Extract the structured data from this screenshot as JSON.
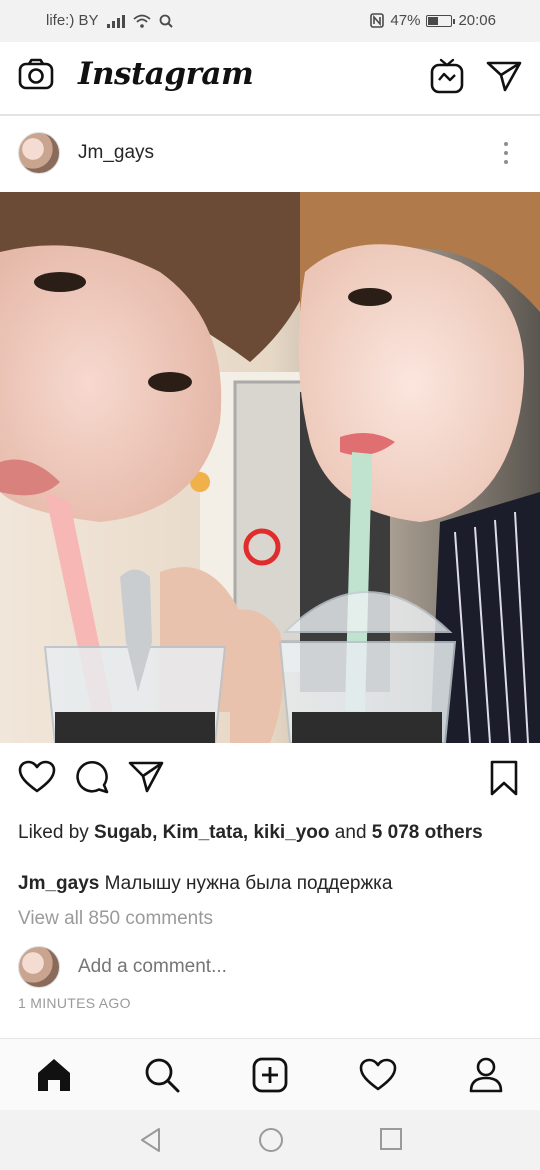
{
  "status_bar": {
    "carrier": "life:) BY",
    "battery_percent": "47%",
    "battery_level": 0.47,
    "time": "20:06",
    "icons": [
      "signal-icon",
      "wifi-icon",
      "search-icon",
      "nfc-icon",
      "battery-icon"
    ]
  },
  "app_header": {
    "logo_text": "Instagram",
    "left_icon": "camera-icon",
    "right_icons": [
      "igtv-icon",
      "direct-message-icon"
    ]
  },
  "post": {
    "username": "Jm_gays",
    "photo_description_icon": "post-photo",
    "liked_by_prefix": "Liked by ",
    "liked_users": [
      "Sugab",
      "Kim_tata",
      "kiki_yoo"
    ],
    "liked_by_and": " and ",
    "liked_others": "5 078 others",
    "caption_username": "Jm_gays",
    "caption_text": " Малышу нужна была поддержка",
    "view_comments": "View all 850 comments",
    "add_comment_placeholder": "Add a comment...",
    "timestamp": "1 MINUTES AGO"
  },
  "actions": [
    "heart-icon",
    "comment-icon",
    "share-icon",
    "bookmark-icon"
  ],
  "bottom_nav": [
    "home-icon",
    "search-icon",
    "add-post-icon",
    "activity-heart-icon",
    "profile-icon"
  ],
  "system_nav": [
    "back-icon",
    "home-circle-icon",
    "recents-icon"
  ],
  "colors": {
    "text": "#262626",
    "muted": "#9a9a9a",
    "status_bg": "#f2f2f2",
    "nav_bg": "#fafafa"
  }
}
